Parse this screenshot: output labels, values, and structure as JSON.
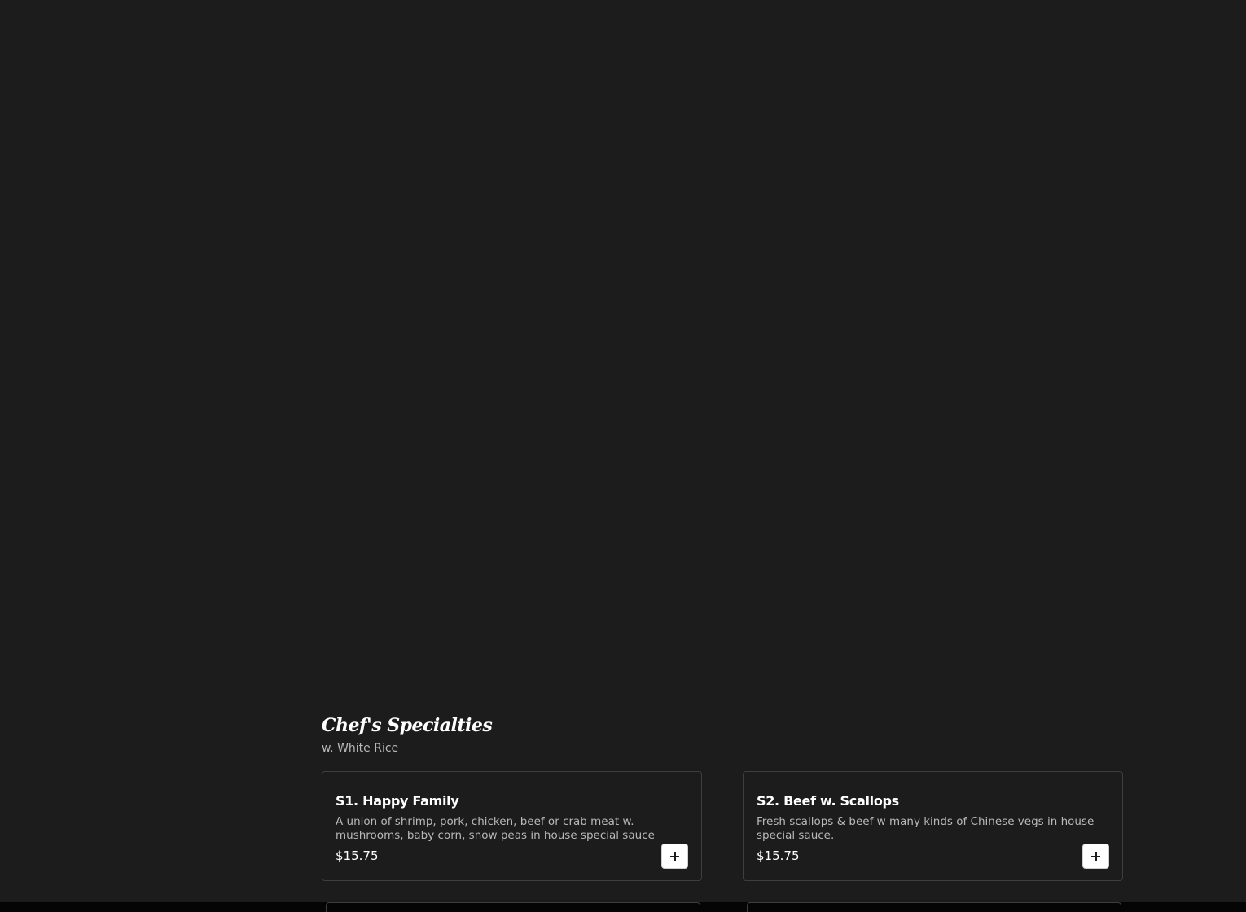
{
  "section": {
    "title": "Chef's Specialties",
    "subtitle": "w. White Rice"
  },
  "items": [
    {
      "name": "S1. Happy Family",
      "description": "A union of shrimp, pork, chicken, beef or crab meat w. mushrooms, baby corn, snow peas in house special sauce",
      "price": "$15.75",
      "action_icon": "plus-icon"
    },
    {
      "name": "S2. Beef w. Scallops",
      "description": "Fresh scallops & beef w many kinds of Chinese vegs in house special sauce.",
      "price": "$15.75",
      "action_icon": "plus-icon"
    }
  ],
  "colors": {
    "background": "#1c1c1c",
    "card_border": "#3e3e3e",
    "text_primary": "#ffffff",
    "text_secondary": "#b8b8b8",
    "button_background": "#ffffff"
  }
}
